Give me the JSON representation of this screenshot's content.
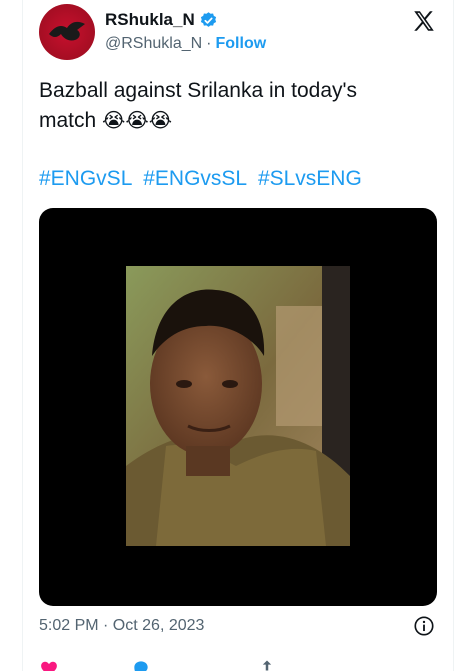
{
  "colors": {
    "brand": "#1d9bf0",
    "text": "#0f1419",
    "muted": "#536471",
    "like": "#f91880"
  },
  "author": {
    "display_name": "RShukla_N",
    "handle": "@RShukla_N",
    "separator": "·",
    "follow_label": "Follow",
    "verified_icon": "verified-badge-icon"
  },
  "header": {
    "logo_icon": "x-logo-icon"
  },
  "tweet": {
    "text_line1": "Bazball against Srilanka in today's",
    "text_line2": "match",
    "emojis": "😭😭😭",
    "hashtags": [
      "#ENGvSL",
      "#ENGvsSL",
      "#SLvsENG"
    ]
  },
  "media": {
    "type": "video-still",
    "icon": "media-thumbnail"
  },
  "footer": {
    "timestamp": "5:02 PM · Oct 26, 2023",
    "info_icon": "info-icon"
  },
  "actions": [
    {
      "icon": "heart-icon"
    },
    {
      "icon": "reply-icon"
    },
    {
      "icon": "share-icon"
    }
  ]
}
